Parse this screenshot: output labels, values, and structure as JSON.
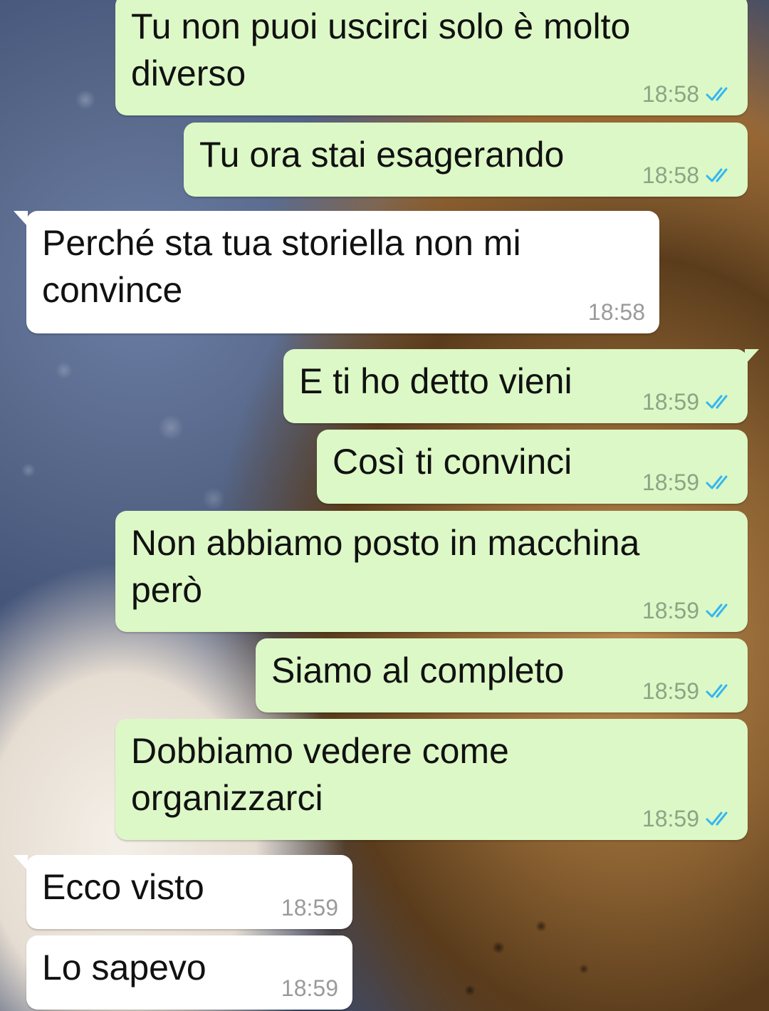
{
  "colors": {
    "outgoing_bubble": "#dcf8c6",
    "incoming_bubble": "#ffffff",
    "read_ticks": "#34b7f1"
  },
  "messages": [
    {
      "direction": "out",
      "text": "Tu non puoi uscirci solo è molto\ndiverso",
      "time": "18:58",
      "status_icon": "double-check-read-icon"
    },
    {
      "direction": "out",
      "text": "Tu ora stai esagerando",
      "time": "18:58",
      "status_icon": "double-check-read-icon"
    },
    {
      "direction": "in",
      "text": "Perché sta tua storiella non mi\nconvince",
      "time": "18:58"
    },
    {
      "direction": "out",
      "text": "E ti ho detto vieni",
      "time": "18:59",
      "status_icon": "double-check-read-icon"
    },
    {
      "direction": "out",
      "text": "Così ti convinci",
      "time": "18:59",
      "status_icon": "double-check-read-icon"
    },
    {
      "direction": "out",
      "text": "Non abbiamo posto in macchina\nperò",
      "time": "18:59",
      "status_icon": "double-check-read-icon"
    },
    {
      "direction": "out",
      "text": "Siamo al completo",
      "time": "18:59",
      "status_icon": "double-check-read-icon"
    },
    {
      "direction": "out",
      "text": "Dobbiamo vedere come\norganizzarci",
      "time": "18:59",
      "status_icon": "double-check-read-icon"
    },
    {
      "direction": "in",
      "text": "Ecco visto",
      "time": "18:59"
    },
    {
      "direction": "in",
      "text": "Lo sapevo",
      "time": "18:59"
    }
  ]
}
